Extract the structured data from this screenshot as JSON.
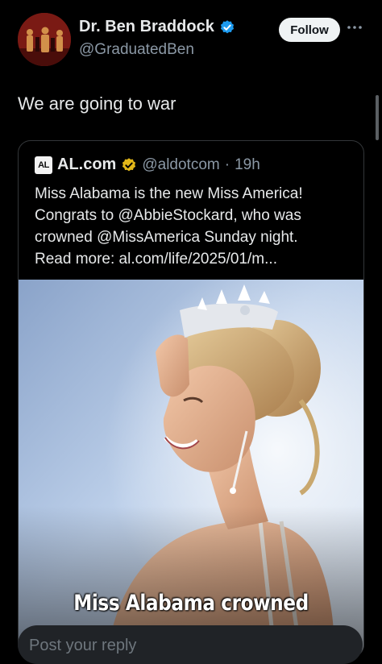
{
  "author": {
    "display_name": "Dr. Ben Braddock",
    "handle": "@GraduatedBen",
    "verified": true,
    "verified_color": "#1d9bf0"
  },
  "actions": {
    "follow_label": "Follow",
    "more_icon": "more-horizontal-icon"
  },
  "tweet": {
    "text": "We are going to war"
  },
  "quoted_tweet": {
    "logo_text": "AL",
    "display_name": "AL.com",
    "badge_color": "#e2b719",
    "handle": "@aldotcom",
    "separator": "·",
    "time": "19h",
    "body_lines": [
      "Miss Alabama is the new Miss America!",
      "Congrats to @AbbieStockard, who was",
      "crowned @MissAmerica Sunday night.",
      "Read more: al.com/life/2025/01/m..."
    ],
    "media_caption": "Miss Alabama crowned"
  },
  "reply": {
    "placeholder": "Post your reply"
  },
  "colors": {
    "background": "#000000",
    "text": "#e7e9ea",
    "secondary_text": "#8b98a5"
  }
}
